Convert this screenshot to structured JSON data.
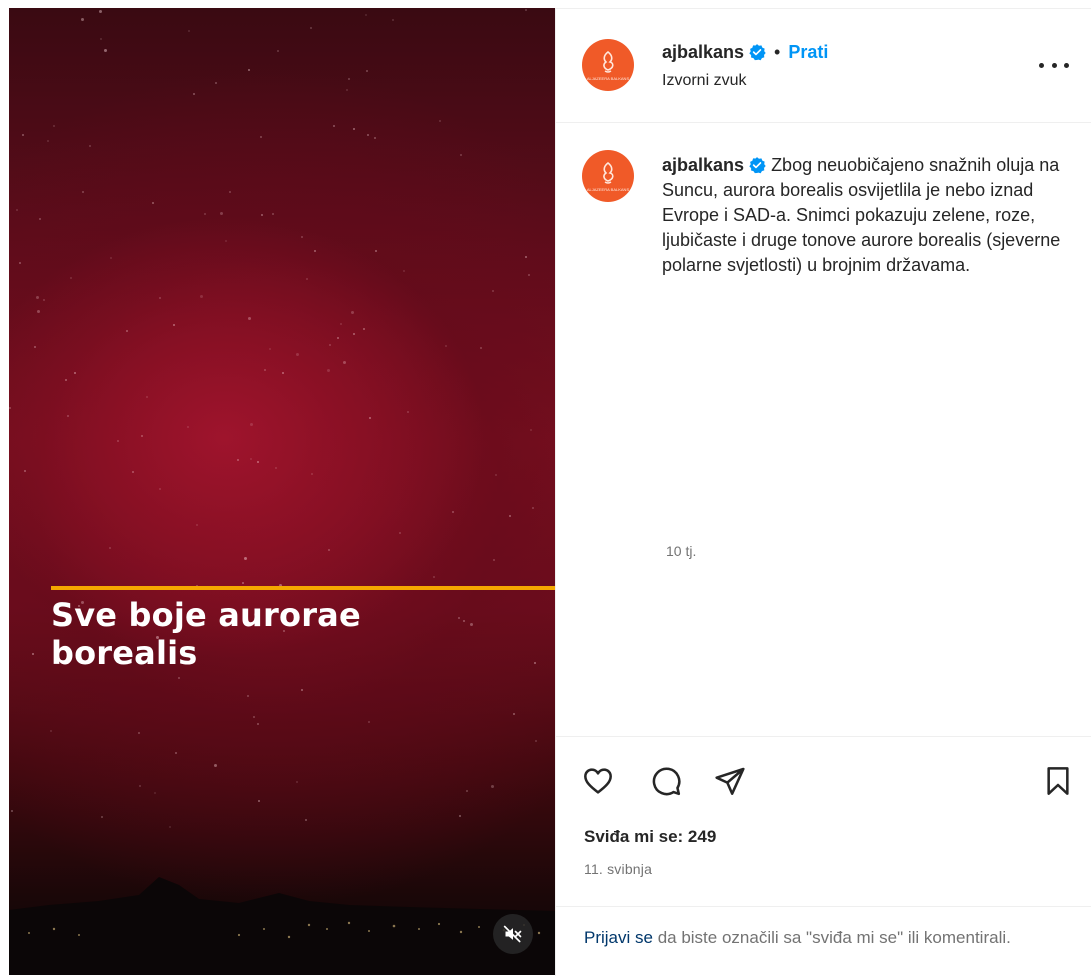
{
  "video": {
    "caption_line1": "Sve boje aurorae",
    "caption_line2": "borealis",
    "accent_color": "#f5a800",
    "mute_icon": "speaker-muted-icon"
  },
  "header": {
    "username": "ajbalkans",
    "separator": "•",
    "follow_label": "Prati",
    "audio_label": "Izvorni zvuk",
    "avatar_logo_text": "ALJAZEERA BALKANS",
    "more_icon": "more-options-icon"
  },
  "post": {
    "username": "ajbalkans",
    "caption": "Zbog neuobičajeno snažnih oluja na Suncu, aurora borealis osvijetlila je nebo iznad Evrope i SAD-a. Snimci pokazuju zelene, roze, ljubičaste i druge tonove aurore borealis (sjeverne polarne svjetlosti) u brojnim državama.",
    "time_ago": "10 tj."
  },
  "actions": {
    "likes_label": "Sviđa mi se: 249",
    "date": "11. svibnja",
    "icons": [
      "heart-icon",
      "comment-icon",
      "share-icon",
      "bookmark-icon"
    ]
  },
  "footer": {
    "login_link": "Prijavi se",
    "login_rest": " da biste označili sa \"sviđa mi se\" ili komentirali."
  },
  "colors": {
    "brand_orange": "#f05a28",
    "link_blue": "#0095f6",
    "verified_blue": "#0095f6"
  }
}
